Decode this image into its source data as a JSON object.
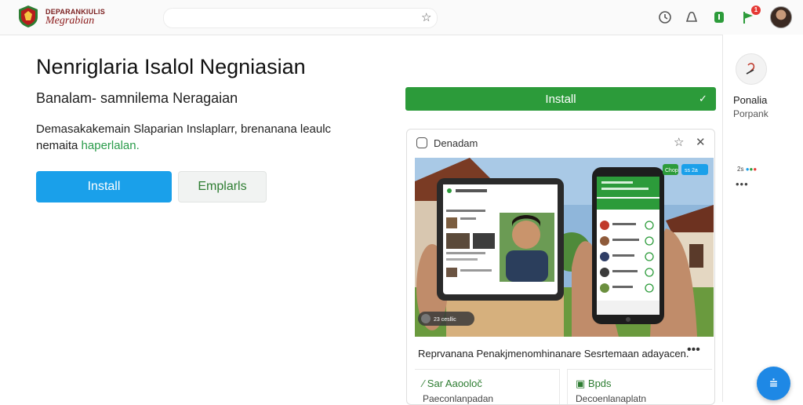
{
  "brand": {
    "top_text": "DEPARANKIULIS",
    "name": "Megrabian"
  },
  "hero": {
    "title": "Nenriglaria Isalol Negniasian",
    "subtitle": "Banalam- samnilema Neragaian",
    "desc_line1": "Demasakakemain Slaparian Inslaplarr, brenanana leaulc",
    "desc_line2_prefix": "nemaita",
    "desc_line2_link": "haperlalan."
  },
  "buttons": {
    "install": "Install",
    "details": "Emplarls",
    "green_install": "Install"
  },
  "card": {
    "header_title": "Denadam",
    "caption": "Reprvanana Penakjmenomhinanare Sesrtemaan adayacen.",
    "sub1": {
      "title": "Sar Aaooloč",
      "text": "Paeconlanpadan"
    },
    "sub2": {
      "title": "Bpds",
      "text": "Decoenlanaplatn"
    },
    "tablet_tag": "23 cesllic",
    "phone_chips": [
      "Chop",
      "ss 2a"
    ]
  },
  "sidebar": {
    "name": "Ponalia",
    "sub": "Porpank",
    "dots_label": "2s",
    "more": "•••"
  },
  "header": {
    "notification_count": "1"
  },
  "colors": {
    "primary_blue": "#1aa0ea",
    "install_green": "#2c9b3a",
    "fab_blue": "#1e88e5",
    "badge_red": "#e53935"
  },
  "icons": [
    "star-icon",
    "clock-icon",
    "puzzle-icon",
    "shield-icon",
    "flag-icon",
    "close-icon",
    "more-icon",
    "layout-icon",
    "check-icon"
  ]
}
